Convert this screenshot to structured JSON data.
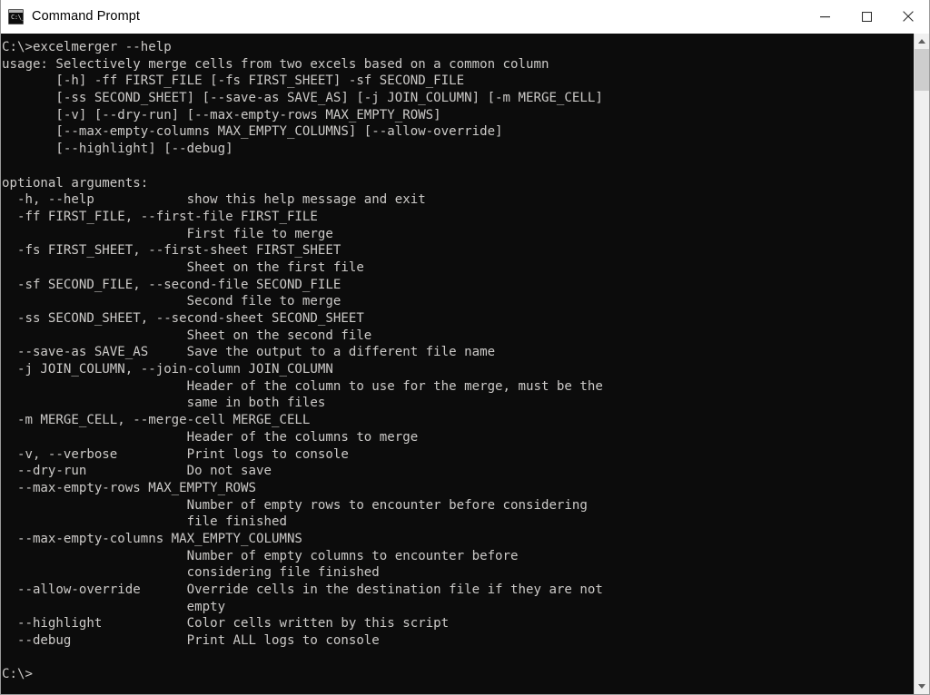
{
  "window": {
    "title": "Command Prompt",
    "icon": "command-prompt-icon",
    "icon_glyph": "C:\\_",
    "background": "#0c0c0c",
    "foreground": "#cccac8",
    "titlebar_background": "#ffffff"
  },
  "titlebar_buttons": {
    "minimize": "minimize-button",
    "maximize": "maximize-button",
    "close": "close-button"
  },
  "scrollbar": {
    "up_arrow": "scroll-up-arrow",
    "down_arrow": "scroll-down-arrow",
    "thumb": "scroll-thumb"
  },
  "console": {
    "prompt_command": "C:\\>excelmerger --help",
    "final_prompt": "C:\\>",
    "lines": [
      "C:\\>excelmerger --help",
      "usage: Selectively merge cells from two excels based on a common column",
      "       [-h] -ff FIRST_FILE [-fs FIRST_SHEET] -sf SECOND_FILE",
      "       [-ss SECOND_SHEET] [--save-as SAVE_AS] [-j JOIN_COLUMN] [-m MERGE_CELL]",
      "       [-v] [--dry-run] [--max-empty-rows MAX_EMPTY_ROWS]",
      "       [--max-empty-columns MAX_EMPTY_COLUMNS] [--allow-override]",
      "       [--highlight] [--debug]",
      "",
      "optional arguments:",
      "  -h, --help            show this help message and exit",
      "  -ff FIRST_FILE, --first-file FIRST_FILE",
      "                        First file to merge",
      "  -fs FIRST_SHEET, --first-sheet FIRST_SHEET",
      "                        Sheet on the first file",
      "  -sf SECOND_FILE, --second-file SECOND_FILE",
      "                        Second file to merge",
      "  -ss SECOND_SHEET, --second-sheet SECOND_SHEET",
      "                        Sheet on the second file",
      "  --save-as SAVE_AS     Save the output to a different file name",
      "  -j JOIN_COLUMN, --join-column JOIN_COLUMN",
      "                        Header of the column to use for the merge, must be the",
      "                        same in both files",
      "  -m MERGE_CELL, --merge-cell MERGE_CELL",
      "                        Header of the columns to merge",
      "  -v, --verbose         Print logs to console",
      "  --dry-run             Do not save",
      "  --max-empty-rows MAX_EMPTY_ROWS",
      "                        Number of empty rows to encounter before considering",
      "                        file finished",
      "  --max-empty-columns MAX_EMPTY_COLUMNS",
      "                        Number of empty columns to encounter before",
      "                        considering file finished",
      "  --allow-override      Override cells in the destination file if they are not",
      "                        empty",
      "  --highlight           Color cells written by this script",
      "  --debug               Print ALL logs to console",
      "",
      "C:\\>"
    ]
  }
}
